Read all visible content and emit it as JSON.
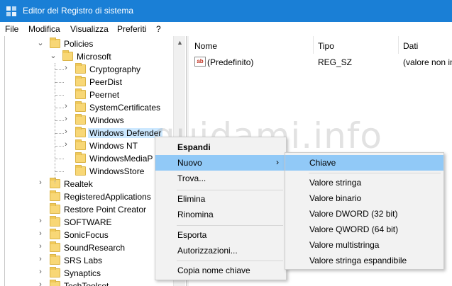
{
  "window": {
    "title": "Editor del Registro di sistema",
    "titlebar_color": "#1a7fd6"
  },
  "menubar": [
    "File",
    "Modifica",
    "Visualizza",
    "Preferiti",
    "?"
  ],
  "tree": {
    "nodes": [
      {
        "label": "Policies",
        "expander": "collapse"
      },
      {
        "label": "Microsoft",
        "expander": "collapse"
      },
      {
        "label": "Cryptography",
        "expander": "expand"
      },
      {
        "label": "PeerDist",
        "expander": ""
      },
      {
        "label": "Peernet",
        "expander": ""
      },
      {
        "label": "SystemCertificates",
        "expander": "expand"
      },
      {
        "label": "Windows",
        "expander": "expand"
      },
      {
        "label": "Windows Defender",
        "expander": "expand",
        "selected": true
      },
      {
        "label": "Windows NT",
        "expander": "expand"
      },
      {
        "label": "WindowsMediaP",
        "expander": ""
      },
      {
        "label": "WindowsStore",
        "expander": ""
      },
      {
        "label": "Realtek",
        "expander": "expand"
      },
      {
        "label": "RegisteredApplications",
        "expander": ""
      },
      {
        "label": "Restore Point Creator",
        "expander": ""
      },
      {
        "label": "SOFTWARE",
        "expander": "expand"
      },
      {
        "label": "SonicFocus",
        "expander": "expand"
      },
      {
        "label": "SoundResearch",
        "expander": "expand"
      },
      {
        "label": "SRS Labs",
        "expander": "expand"
      },
      {
        "label": "Synaptics",
        "expander": "expand"
      },
      {
        "label": "TechToolset",
        "expander": "expand"
      }
    ],
    "selected_color": "#cce8ff"
  },
  "list": {
    "columns": [
      "Nome",
      "Tipo",
      "Dati"
    ],
    "rows": [
      {
        "icon": "ab",
        "name": "(Predefinito)",
        "type": "REG_SZ",
        "data": "(valore non im"
      }
    ]
  },
  "watermark": "guidami.info",
  "context_menu": {
    "items": [
      {
        "label": "Espandi",
        "bold": true
      },
      {
        "label": "Nuovo",
        "has_submenu": true,
        "highlighted": true
      },
      {
        "label": "Trova..."
      },
      {
        "label": "Elimina"
      },
      {
        "label": "Rinomina"
      },
      {
        "label": "Esporta"
      },
      {
        "label": "Autorizzazioni..."
      },
      {
        "label": "Copia nome chiave"
      }
    ],
    "submenu_arrow": "›"
  },
  "submenu": {
    "items": [
      {
        "label": "Chiave",
        "highlighted": true
      },
      {
        "label": "Valore stringa"
      },
      {
        "label": "Valore binario"
      },
      {
        "label": "Valore DWORD (32 bit)"
      },
      {
        "label": "Valore QWORD (64 bit)"
      },
      {
        "label": "Valore multistringa"
      },
      {
        "label": "Valore stringa espandibile"
      }
    ],
    "highlight_color": "#91c9f7"
  }
}
